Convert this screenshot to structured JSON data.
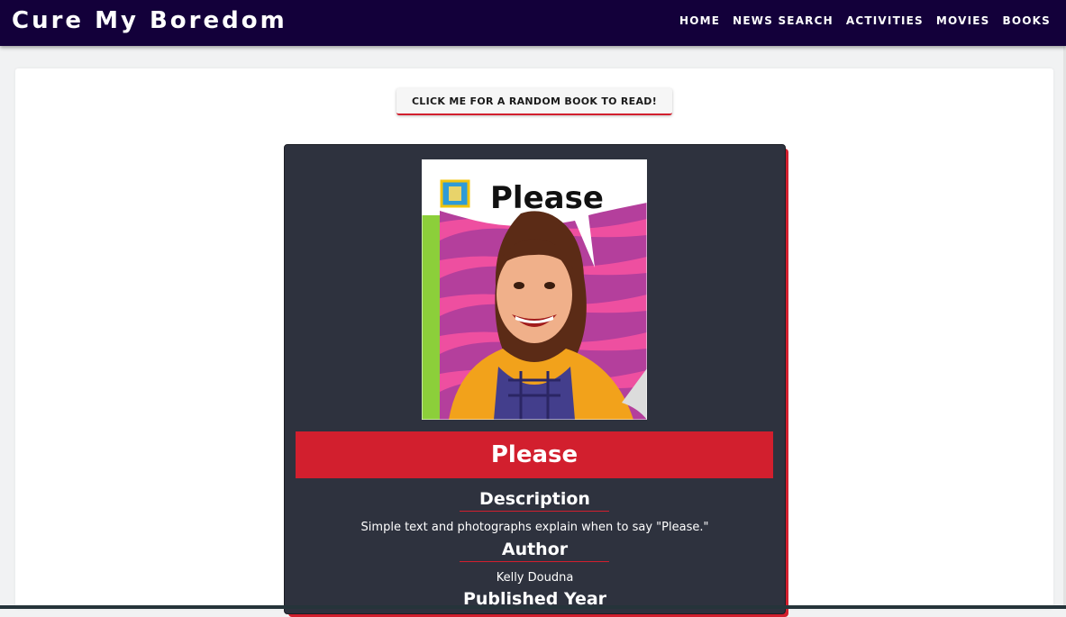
{
  "header": {
    "brand": "Cure My Boredom",
    "nav": [
      {
        "label": "HOME"
      },
      {
        "label": "NEWS SEARCH"
      },
      {
        "label": "ACTIVITIES"
      },
      {
        "label": "MOVIES"
      },
      {
        "label": "BOOKS"
      }
    ]
  },
  "main": {
    "random_button_label": "CLICK ME FOR A RANDOM BOOK TO READ!",
    "book": {
      "cover_title": "Please",
      "title": "Please",
      "description_heading": "Description",
      "description": "Simple text and photographs explain when to say \"Please.\"",
      "author_heading": "Author",
      "author": "Kelly Doudna",
      "published_heading": "Published Year"
    }
  },
  "colors": {
    "navbar": "#13003a",
    "accent": "#d21f2e",
    "card": "#2e323e",
    "page_background": "#f1f2f3"
  },
  "icons": {
    "book_cover": "book-cover-image"
  }
}
